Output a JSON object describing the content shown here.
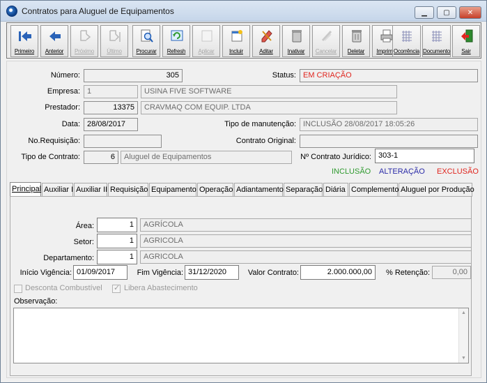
{
  "window": {
    "title": "Contratos para Aluguel de Equipamentos"
  },
  "toolbar": {
    "buttons": [
      {
        "label": "Primeiro",
        "icon": "first-record-icon",
        "enabled": true
      },
      {
        "label": "Anterior",
        "icon": "prev-record-icon",
        "enabled": true
      },
      {
        "label": "Próximo",
        "icon": "next-record-icon",
        "enabled": false
      },
      {
        "label": "Último",
        "icon": "last-record-icon",
        "enabled": false
      },
      {
        "label": "Procurar",
        "icon": "search-icon",
        "enabled": true
      },
      {
        "label": "Refresh",
        "icon": "refresh-icon",
        "enabled": true
      },
      {
        "label": "Aplicar",
        "icon": "apply-icon",
        "enabled": false
      },
      {
        "label": "Incluir",
        "icon": "add-icon",
        "enabled": true
      },
      {
        "label": "Aditar",
        "icon": "edit-icon",
        "enabled": true
      },
      {
        "label": "Inativar",
        "icon": "inactivate-icon",
        "enabled": true
      },
      {
        "label": "Cancelar",
        "icon": "cancel-icon",
        "enabled": false
      },
      {
        "label": "Deletar",
        "icon": "delete-icon",
        "enabled": true
      },
      {
        "label": "Imprimir",
        "icon": "print-icon",
        "enabled": true
      },
      {
        "label": "Ocorrência",
        "icon": "occurrence-icon",
        "enabled": true
      },
      {
        "label": "Documento",
        "icon": "document-icon",
        "enabled": true
      },
      {
        "label": "Sair",
        "icon": "exit-icon",
        "enabled": true
      }
    ]
  },
  "header": {
    "numero_label": "Número:",
    "numero": "305",
    "status_label": "Status:",
    "status": "EM CRIAÇÃO",
    "empresa_label": "Empresa:",
    "empresa_cod": "1",
    "empresa_nome": "USINA FIVE SOFTWARE",
    "prestador_label": "Prestador:",
    "prestador_cod": "13375",
    "prestador_nome": "CRAVMAQ COM EQUIP. LTDA",
    "data_label": "Data:",
    "data": "28/08/2017",
    "manutencao_label": "Tipo de manutenção:",
    "manutencao": "INCLUSÃO 28/08/2017 18:05:26",
    "norequisicao_label": "No.Requisição:",
    "norequisicao": "",
    "contrato_original_label": "Contrato Original:",
    "contrato_original": "",
    "tipo_contrato_label": "Tipo de Contrato:",
    "tipo_contrato_cod": "6",
    "tipo_contrato_nome": "Aluguel de Equipamentos",
    "contrato_juridico_label": "Nº Contrato Jurídico:",
    "contrato_juridico": "303-1"
  },
  "legend": {
    "inclusao": "INCLUSÃO",
    "alteracao": "ALTERAÇÃO",
    "exclusao": "EXCLUSÃO"
  },
  "colors": {
    "inclusao": "#2f9a2f",
    "alteracao": "#2b2ba8",
    "exclusao": "#e0251e",
    "status": "#e0251e"
  },
  "tabs": [
    "Principal",
    "Auxiliar I",
    "Auxiliar II",
    "Requisição",
    "Equipamento",
    "Operação",
    "Adiantamento",
    "Separação",
    "Diária",
    "Complemento",
    "Aluguel por Produção"
  ],
  "principal": {
    "area_label": "Área:",
    "area_cod": "1",
    "area_nome": "AGRÍCOLA",
    "setor_label": "Setor:",
    "setor_cod": "1",
    "setor_nome": "AGRICOLA",
    "depto_label": "Departamento:",
    "depto_cod": "1",
    "depto_nome": "AGRICOLA",
    "inicio_label": "Início Vigência:",
    "inicio": "01/09/2017",
    "fim_label": "Fim Vigência:",
    "fim": "31/12/2020",
    "valor_label": "Valor Contrato:",
    "valor": "2.000.000,00",
    "retencao_label": "% Retenção:",
    "retencao": "0,00",
    "desconta_label": "Desconta Combustível",
    "libera_label": "Libera Abastecimento",
    "obs_label": "Observação:",
    "obs": ""
  }
}
